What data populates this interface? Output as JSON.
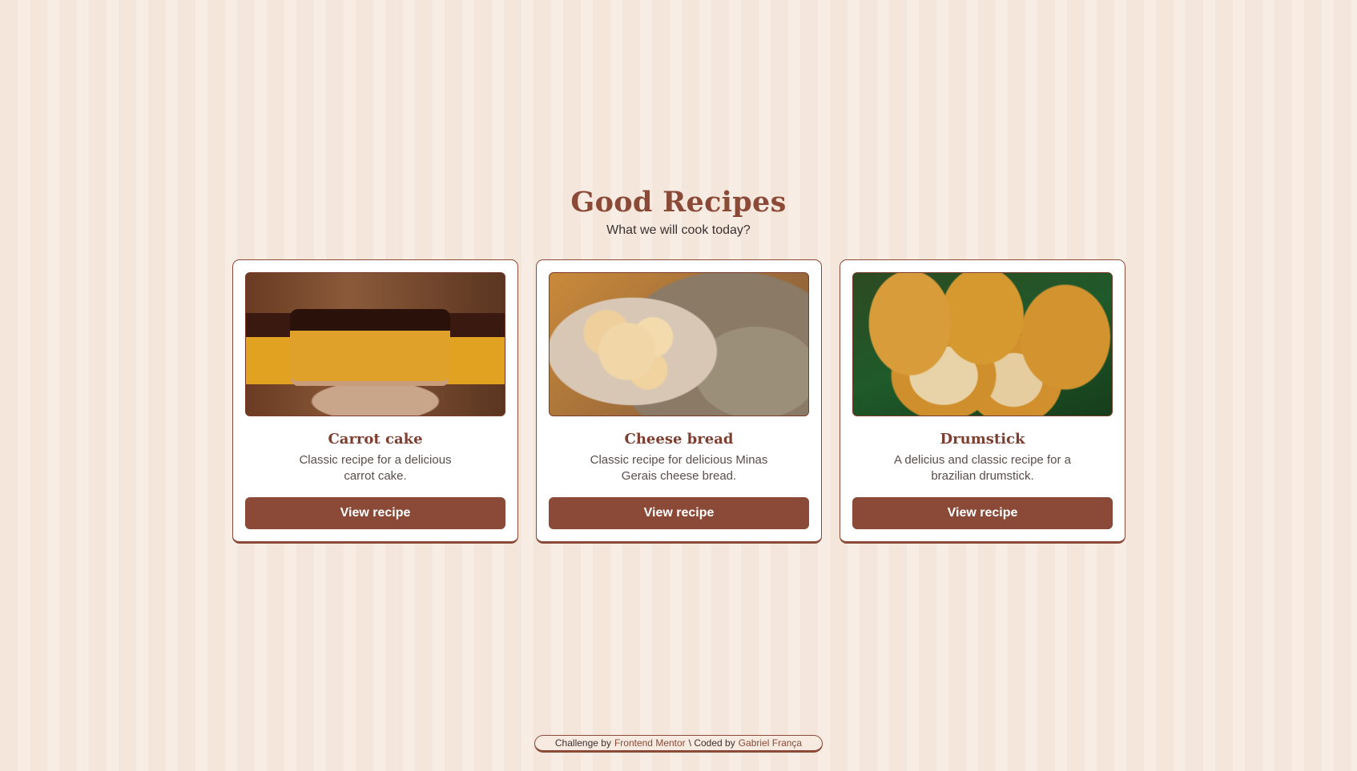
{
  "header": {
    "title": "Good Recipes",
    "subtitle": "What we will cook today?"
  },
  "cards": [
    {
      "title": "Carrot cake",
      "description": "Classic recipe for a delicious carrot cake.",
      "button_label": "View recipe",
      "image_alt": "carrot cake with chocolate topping"
    },
    {
      "title": "Cheese bread",
      "description": "Classic recipe for delicious Minas Gerais cheese bread.",
      "button_label": "View recipe",
      "image_alt": "plate of cheese bread"
    },
    {
      "title": "Drumstick",
      "description": "A delicius and classic recipe for a brazilian drumstick.",
      "button_label": "View recipe",
      "image_alt": "fried drumstick croquettes"
    }
  ],
  "footer": {
    "challenge_prefix": "Challenge by",
    "challenge_link": "Frontend Mentor",
    "separator": "\\ Coded by",
    "author_link": "Gabriel França"
  },
  "colors": {
    "accent": "#8a4a37",
    "background": "#f4e7dc",
    "card": "#ffffff"
  }
}
